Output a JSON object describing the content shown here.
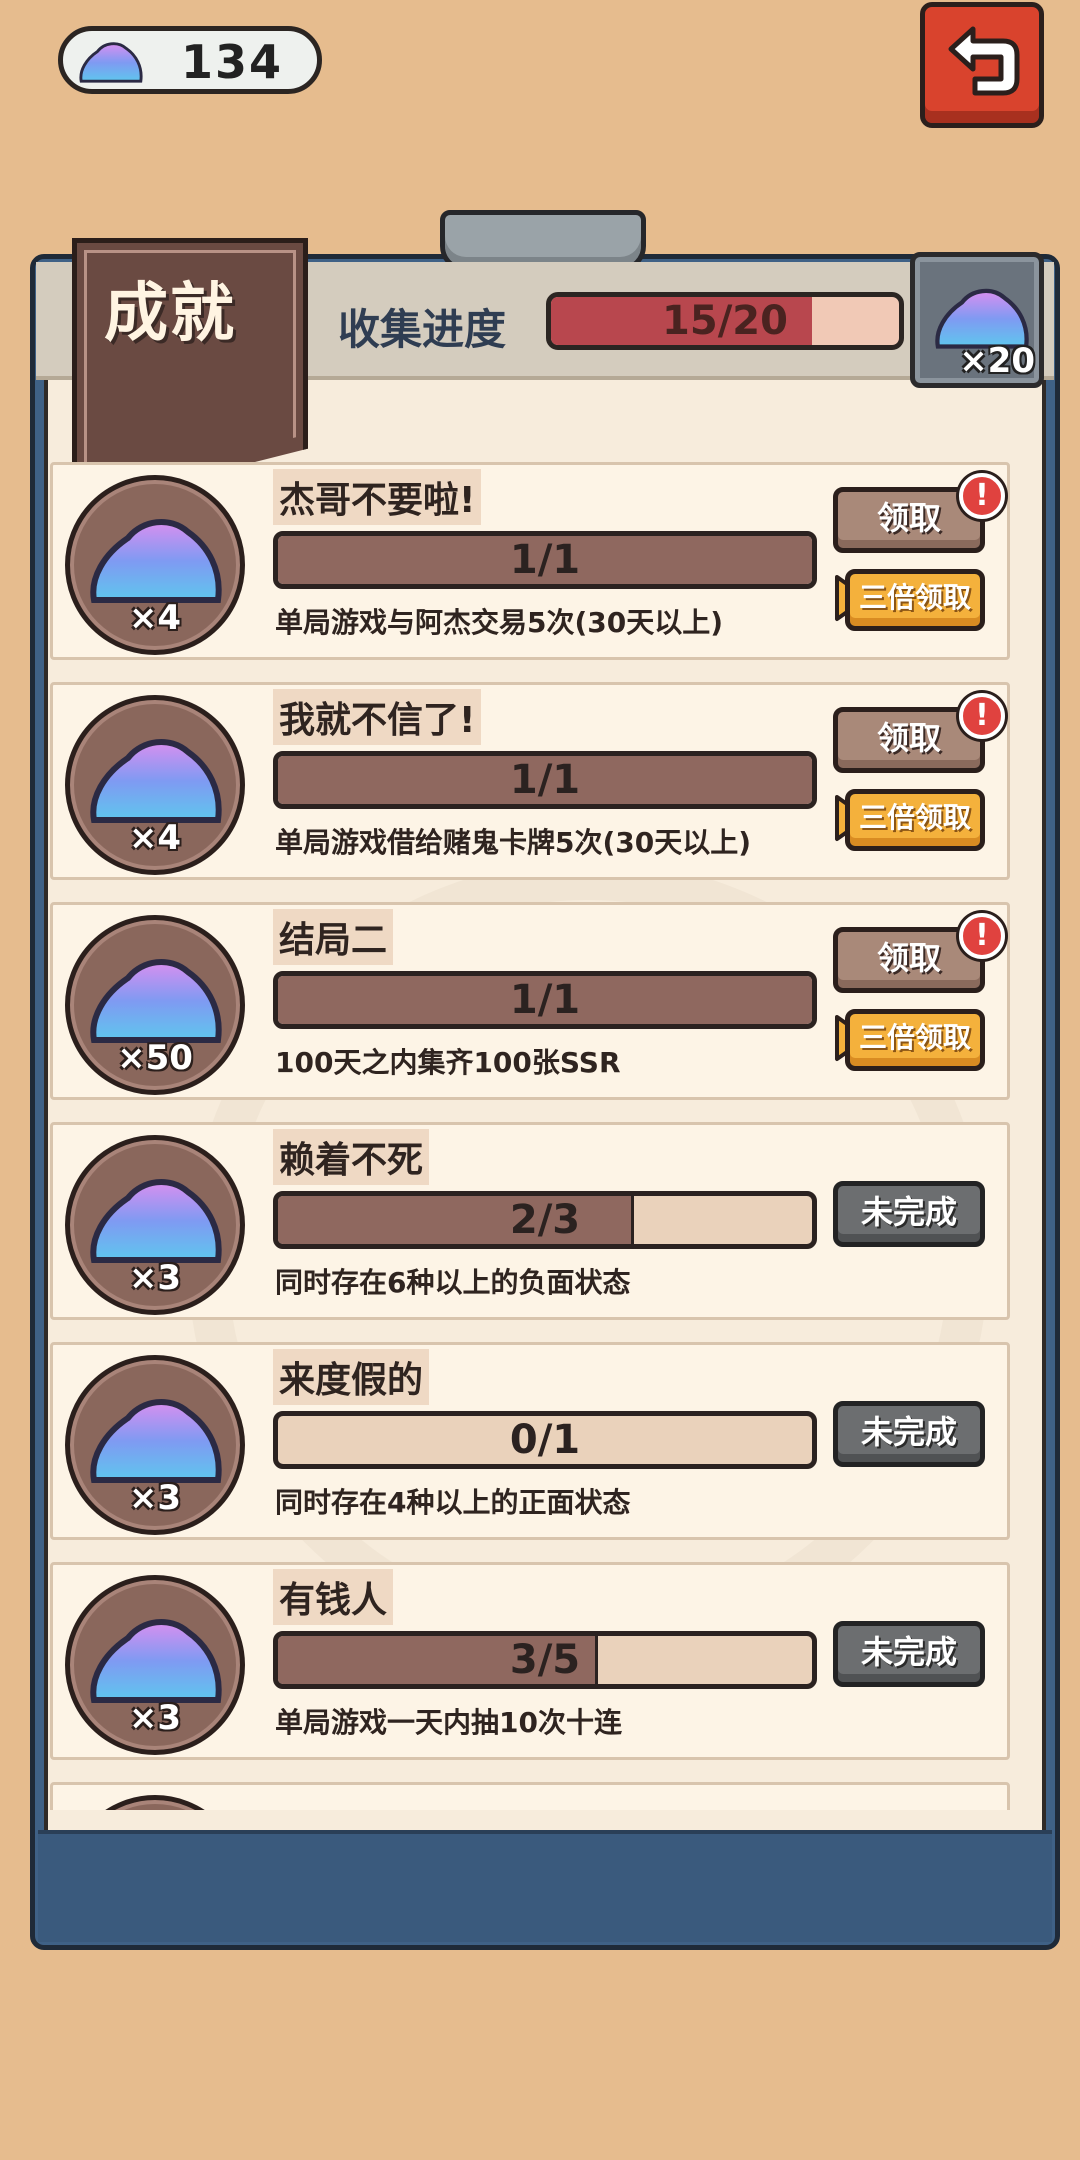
{
  "currency": {
    "value": "134",
    "icon": "crystal-ore-icon"
  },
  "header": {
    "title": "成就",
    "collect_label": "收集进度",
    "collect_progress": "15/20",
    "collect_fraction": 0.75,
    "reward_multiplier": "×20"
  },
  "buttons": {
    "claim": "领取",
    "triple_claim": "三倍领取",
    "incomplete": "未完成",
    "badge": "!"
  },
  "achievements": [
    {
      "title": "杰哥不要啦!",
      "progress": "1/1",
      "fraction": 1.0,
      "reward": "×4",
      "desc": "单局游戏与阿杰交易5次(30天以上)",
      "status": "claimable"
    },
    {
      "title": "我就不信了!",
      "progress": "1/1",
      "fraction": 1.0,
      "reward": "×4",
      "desc": "单局游戏借给赌鬼卡牌5次(30天以上)",
      "status": "claimable"
    },
    {
      "title": "结局二",
      "progress": "1/1",
      "fraction": 1.0,
      "reward": "×50",
      "desc": "100天之内集齐100张SSR",
      "status": "claimable"
    },
    {
      "title": "赖着不死",
      "progress": "2/3",
      "fraction": 0.667,
      "reward": "×3",
      "desc": "同时存在6种以上的负面状态",
      "status": "incomplete"
    },
    {
      "title": "来度假的",
      "progress": "0/1",
      "fraction": 0.0,
      "reward": "×3",
      "desc": "同时存在4种以上的正面状态",
      "status": "incomplete"
    },
    {
      "title": "有钱人",
      "progress": "3/5",
      "fraction": 0.6,
      "reward": "×3",
      "desc": "单局游戏一天内抽10次十连",
      "status": "incomplete"
    }
  ],
  "colors": {
    "background": "#e6bc8e",
    "board": "#3f6186",
    "progress_fill": "#8f685f",
    "collect_fill": "#b8474e",
    "claim_button": "#a98979",
    "triple_button": "#f4b13c",
    "incomplete_button": "#6c6e70",
    "badge": "#e0423f"
  }
}
